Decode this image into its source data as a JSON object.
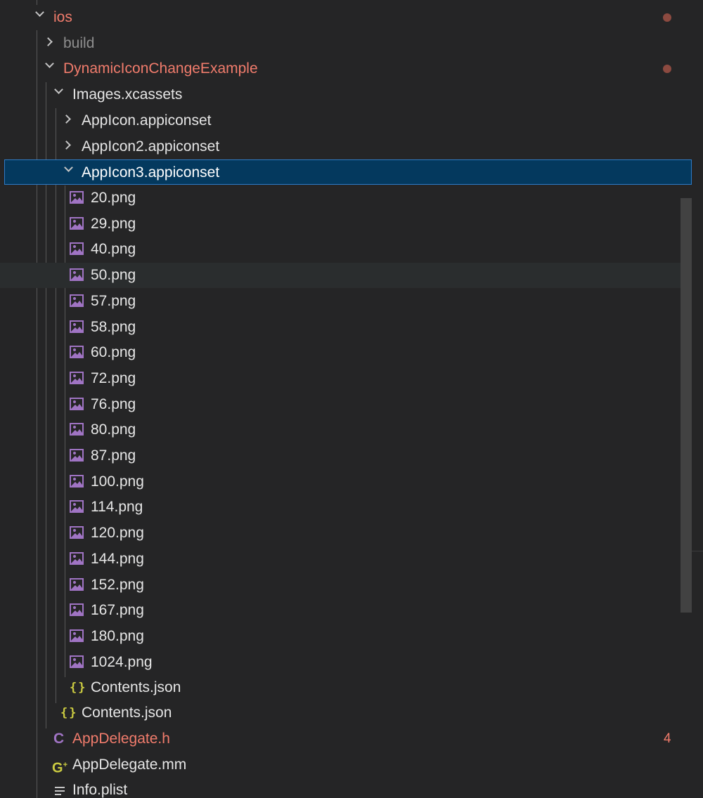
{
  "explorer": {
    "ios": {
      "label": "ios"
    },
    "build": {
      "label": "build"
    },
    "dynamic": {
      "label": "DynamicIconChangeExample"
    },
    "images": {
      "label": "Images.xcassets"
    },
    "appicon1": {
      "label": "AppIcon.appiconset"
    },
    "appicon2": {
      "label": "AppIcon2.appiconset"
    },
    "appicon3": {
      "label": "AppIcon3.appiconset"
    },
    "files": [
      "20.png",
      "29.png",
      "40.png",
      "50.png",
      "57.png",
      "58.png",
      "60.png",
      "72.png",
      "76.png",
      "80.png",
      "87.png",
      "100.png",
      "114.png",
      "120.png",
      "144.png",
      "152.png",
      "167.png",
      "180.png",
      "1024.png"
    ],
    "contents_inner": {
      "label": "Contents.json"
    },
    "contents_outer": {
      "label": "Contents.json"
    },
    "appdelegate_h": {
      "label": "AppDelegate.h",
      "problems": "4"
    },
    "appdelegate_mm": {
      "label": "AppDelegate.mm"
    },
    "info_plist": {
      "label": "Info.plist"
    }
  },
  "colors": {
    "background": "#252526",
    "selected_row": "#04395e",
    "selected_border": "#2f7bc6",
    "modified_text": "#f17c6c",
    "image_icon": "#a074c4",
    "json_icon": "#cbcb41"
  },
  "icons": {
    "folder_open": "chevron-down-icon",
    "folder_closed": "chevron-right-icon",
    "png_file": "image-file-icon",
    "json_file": "json-braces-icon",
    "header_file": "c-header-icon",
    "objcpp_file": "cpp-icon",
    "plist_file": "list-lines-icon"
  }
}
